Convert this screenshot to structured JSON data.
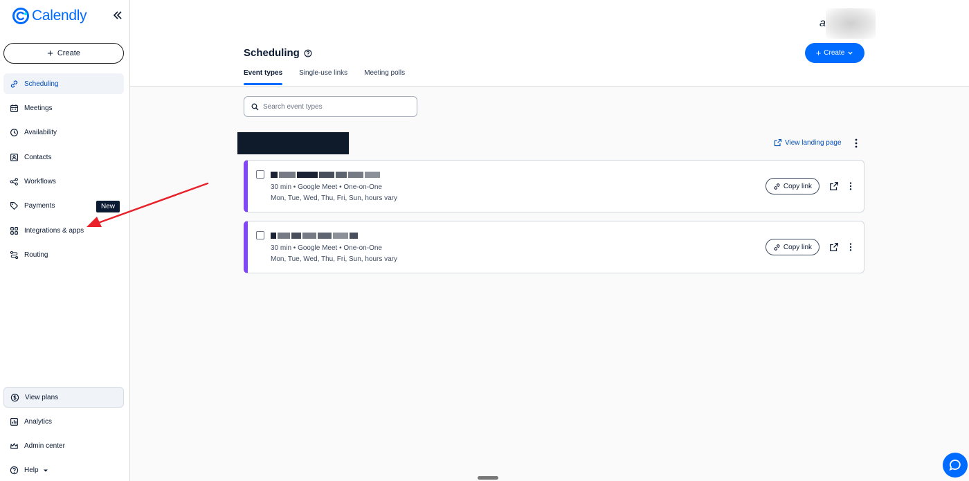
{
  "brand": {
    "name": "Calendly",
    "color": "#006bff"
  },
  "sidebar": {
    "create_label": "Create",
    "items": [
      {
        "label": "Scheduling",
        "icon": "link-icon",
        "active": true
      },
      {
        "label": "Meetings",
        "icon": "calendar-icon"
      },
      {
        "label": "Availability",
        "icon": "clock-icon"
      },
      {
        "label": "Contacts",
        "icon": "contact-card-icon"
      },
      {
        "label": "Workflows",
        "icon": "workflow-icon"
      },
      {
        "label": "Payments",
        "icon": "tag-icon",
        "badge": "New"
      },
      {
        "label": "Integrations & apps",
        "icon": "grid-icon"
      },
      {
        "label": "Routing",
        "icon": "routing-icon"
      }
    ],
    "bottom": {
      "view_plans": "View plans",
      "analytics": "Analytics",
      "admin_center": "Admin center",
      "help": "Help"
    }
  },
  "header": {
    "avatar_letter": "a",
    "title": "Scheduling",
    "create_label": "Create",
    "tabs": [
      {
        "label": "Event types",
        "active": true
      },
      {
        "label": "Single-use links"
      },
      {
        "label": "Meeting polls"
      }
    ]
  },
  "main": {
    "search_placeholder": "Search event types",
    "view_landing_page": "View landing page",
    "events": [
      {
        "meta": "30 min • Google Meet • One-on-One",
        "hours": "Mon, Tue, Wed, Thu, Fri, Sun, hours vary",
        "copy_label": "Copy link",
        "accent": "#8247f5"
      },
      {
        "meta": "30 min • Google Meet • One-on-One",
        "hours": "Mon, Tue, Wed, Thu, Fri, Sun, hours vary",
        "copy_label": "Copy link",
        "accent": "#8247f5"
      }
    ]
  },
  "annotation": {
    "arrow_color": "#e8212a"
  }
}
